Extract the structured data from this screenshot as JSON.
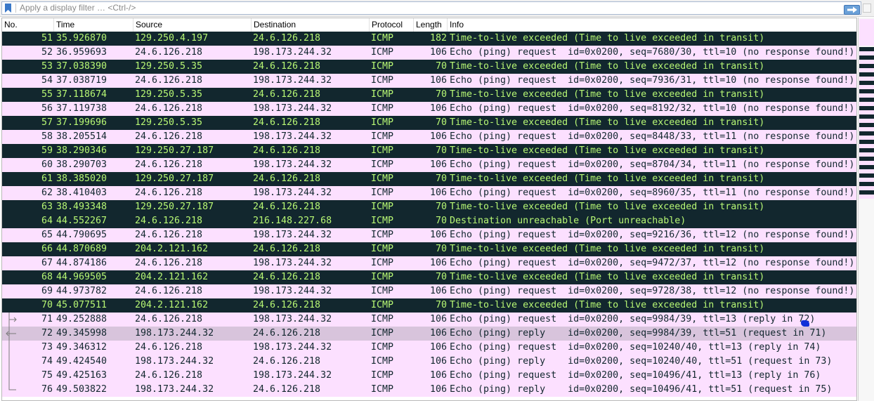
{
  "filter": {
    "placeholder": "Apply a display filter … <Ctrl-/>",
    "bookmark_icon": "bookmark-icon",
    "apply_icon": "arrow-right-icon"
  },
  "columns": {
    "no": "No.",
    "time": "Time",
    "source": "Source",
    "destination": "Destination",
    "protocol": "Protocol",
    "length": "Length",
    "info": "Info"
  },
  "colors": {
    "icmp_error_bg": "#12272e",
    "icmp_error_fg": "#b7f774",
    "icmp_bg": "#fce0ff",
    "icmp_fg": "#12272e",
    "related_bg": "#d8c4dc"
  },
  "packets": [
    {
      "no": "51",
      "time": "35.926870",
      "src": "129.250.4.197",
      "dst": "24.6.126.218",
      "proto": "ICMP",
      "len": "182",
      "info": "Time-to-live exceeded (Time to live exceeded in transit)",
      "style": "icmp-err"
    },
    {
      "no": "52",
      "time": "36.959693",
      "src": "24.6.126.218",
      "dst": "198.173.244.32",
      "proto": "ICMP",
      "len": "106",
      "info": "Echo (ping) request  id=0x0200, seq=7680/30, ttl=10 (no response found!)",
      "style": "icmp-ok"
    },
    {
      "no": "53",
      "time": "37.038390",
      "src": "129.250.5.35",
      "dst": "24.6.126.218",
      "proto": "ICMP",
      "len": "70",
      "info": "Time-to-live exceeded (Time to live exceeded in transit)",
      "style": "icmp-err"
    },
    {
      "no": "54",
      "time": "37.038719",
      "src": "24.6.126.218",
      "dst": "198.173.244.32",
      "proto": "ICMP",
      "len": "106",
      "info": "Echo (ping) request  id=0x0200, seq=7936/31, ttl=10 (no response found!)",
      "style": "icmp-ok"
    },
    {
      "no": "55",
      "time": "37.118674",
      "src": "129.250.5.35",
      "dst": "24.6.126.218",
      "proto": "ICMP",
      "len": "70",
      "info": "Time-to-live exceeded (Time to live exceeded in transit)",
      "style": "icmp-err"
    },
    {
      "no": "56",
      "time": "37.119738",
      "src": "24.6.126.218",
      "dst": "198.173.244.32",
      "proto": "ICMP",
      "len": "106",
      "info": "Echo (ping) request  id=0x0200, seq=8192/32, ttl=10 (no response found!)",
      "style": "icmp-ok"
    },
    {
      "no": "57",
      "time": "37.199696",
      "src": "129.250.5.35",
      "dst": "24.6.126.218",
      "proto": "ICMP",
      "len": "70",
      "info": "Time-to-live exceeded (Time to live exceeded in transit)",
      "style": "icmp-err"
    },
    {
      "no": "58",
      "time": "38.205514",
      "src": "24.6.126.218",
      "dst": "198.173.244.32",
      "proto": "ICMP",
      "len": "106",
      "info": "Echo (ping) request  id=0x0200, seq=8448/33, ttl=11 (no response found!)",
      "style": "icmp-ok"
    },
    {
      "no": "59",
      "time": "38.290346",
      "src": "129.250.27.187",
      "dst": "24.6.126.218",
      "proto": "ICMP",
      "len": "70",
      "info": "Time-to-live exceeded (Time to live exceeded in transit)",
      "style": "icmp-err"
    },
    {
      "no": "60",
      "time": "38.290703",
      "src": "24.6.126.218",
      "dst": "198.173.244.32",
      "proto": "ICMP",
      "len": "106",
      "info": "Echo (ping) request  id=0x0200, seq=8704/34, ttl=11 (no response found!)",
      "style": "icmp-ok"
    },
    {
      "no": "61",
      "time": "38.385020",
      "src": "129.250.27.187",
      "dst": "24.6.126.218",
      "proto": "ICMP",
      "len": "70",
      "info": "Time-to-live exceeded (Time to live exceeded in transit)",
      "style": "icmp-err"
    },
    {
      "no": "62",
      "time": "38.410403",
      "src": "24.6.126.218",
      "dst": "198.173.244.32",
      "proto": "ICMP",
      "len": "106",
      "info": "Echo (ping) request  id=0x0200, seq=8960/35, ttl=11 (no response found!)",
      "style": "icmp-ok"
    },
    {
      "no": "63",
      "time": "38.493348",
      "src": "129.250.27.187",
      "dst": "24.6.126.218",
      "proto": "ICMP",
      "len": "70",
      "info": "Time-to-live exceeded (Time to live exceeded in transit)",
      "style": "icmp-err"
    },
    {
      "no": "64",
      "time": "44.552267",
      "src": "24.6.126.218",
      "dst": "216.148.227.68",
      "proto": "ICMP",
      "len": "70",
      "info": "Destination unreachable (Port unreachable)",
      "style": "icmp-err"
    },
    {
      "no": "65",
      "time": "44.790695",
      "src": "24.6.126.218",
      "dst": "198.173.244.32",
      "proto": "ICMP",
      "len": "106",
      "info": "Echo (ping) request  id=0x0200, seq=9216/36, ttl=12 (no response found!)",
      "style": "icmp-ok"
    },
    {
      "no": "66",
      "time": "44.870689",
      "src": "204.2.121.162",
      "dst": "24.6.126.218",
      "proto": "ICMP",
      "len": "70",
      "info": "Time-to-live exceeded (Time to live exceeded in transit)",
      "style": "icmp-err"
    },
    {
      "no": "67",
      "time": "44.874186",
      "src": "24.6.126.218",
      "dst": "198.173.244.32",
      "proto": "ICMP",
      "len": "106",
      "info": "Echo (ping) request  id=0x0200, seq=9472/37, ttl=12 (no response found!)",
      "style": "icmp-ok"
    },
    {
      "no": "68",
      "time": "44.969505",
      "src": "204.2.121.162",
      "dst": "24.6.126.218",
      "proto": "ICMP",
      "len": "70",
      "info": "Time-to-live exceeded (Time to live exceeded in transit)",
      "style": "icmp-err"
    },
    {
      "no": "69",
      "time": "44.973782",
      "src": "24.6.126.218",
      "dst": "198.173.244.32",
      "proto": "ICMP",
      "len": "106",
      "info": "Echo (ping) request  id=0x0200, seq=9728/38, ttl=12 (no response found!)",
      "style": "icmp-ok"
    },
    {
      "no": "70",
      "time": "45.077511",
      "src": "204.2.121.162",
      "dst": "24.6.126.218",
      "proto": "ICMP",
      "len": "70",
      "info": "Time-to-live exceeded (Time to live exceeded in transit)",
      "style": "icmp-err"
    },
    {
      "no": "71",
      "time": "49.252888",
      "src": "24.6.126.218",
      "dst": "198.173.244.32",
      "proto": "ICMP",
      "len": "106",
      "info": "Echo (ping) request  id=0x0200, seq=9984/39, ttl=13 (reply in 72)",
      "style": "icmp-ok",
      "related": "request"
    },
    {
      "no": "72",
      "time": "49.345998",
      "src": "198.173.244.32",
      "dst": "24.6.126.218",
      "proto": "ICMP",
      "len": "106",
      "info": "Echo (ping) reply    id=0x0200, seq=9984/39, ttl=51 (request in 71)",
      "style": "selected-related",
      "related": "reply"
    },
    {
      "no": "73",
      "time": "49.346312",
      "src": "24.6.126.218",
      "dst": "198.173.244.32",
      "proto": "ICMP",
      "len": "106",
      "info": "Echo (ping) request  id=0x0200, seq=10240/40, ttl=13 (reply in 74)",
      "style": "icmp-ok",
      "related": "line"
    },
    {
      "no": "74",
      "time": "49.424540",
      "src": "198.173.244.32",
      "dst": "24.6.126.218",
      "proto": "ICMP",
      "len": "106",
      "info": "Echo (ping) reply    id=0x0200, seq=10240/40, ttl=51 (request in 73)",
      "style": "icmp-ok",
      "related": "line"
    },
    {
      "no": "75",
      "time": "49.425163",
      "src": "24.6.126.218",
      "dst": "198.173.244.32",
      "proto": "ICMP",
      "len": "106",
      "info": "Echo (ping) request  id=0x0200, seq=10496/41, ttl=13 (reply in 76)",
      "style": "icmp-ok",
      "related": "line"
    },
    {
      "no": "76",
      "time": "49.503822",
      "src": "198.173.244.32",
      "dst": "24.6.126.218",
      "proto": "ICMP",
      "len": "106",
      "info": "Echo (ping) reply    id=0x0200, seq=10496/41, ttl=51 (request in 75)",
      "style": "icmp-ok",
      "related": "end"
    }
  ]
}
